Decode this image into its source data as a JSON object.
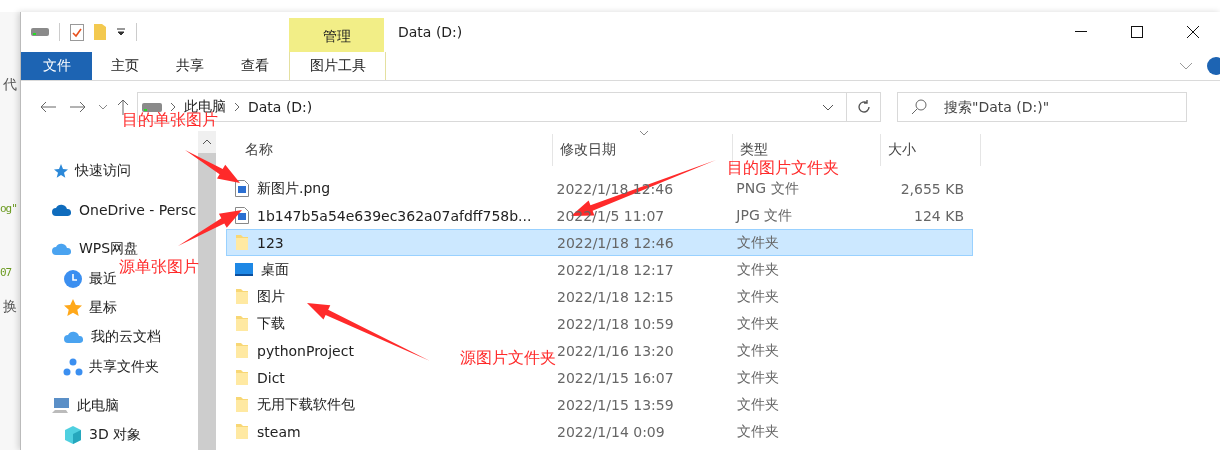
{
  "background_page": {
    "side_texts": [
      {
        "text": "代",
        "kind": "text"
      },
      {
        "text": "og\"",
        "kind": "code"
      },
      {
        "text": "07",
        "kind": "code"
      },
      {
        "text": "换",
        "kind": "text"
      }
    ]
  },
  "window": {
    "title": "Data (D:)"
  },
  "ribbon": {
    "contextual_header": "管理",
    "tabs": [
      {
        "label": "文件",
        "kind": "file"
      },
      {
        "label": "主页",
        "kind": "normal"
      },
      {
        "label": "共享",
        "kind": "normal"
      },
      {
        "label": "查看",
        "kind": "normal"
      },
      {
        "label": "图片工具",
        "kind": "contextual"
      }
    ]
  },
  "address_bar": {
    "breadcrumbs": [
      "此电脑",
      "Data (D:)"
    ]
  },
  "search": {
    "placeholder": "搜索\"Data (D:)\""
  },
  "navigation_pane": {
    "items": [
      {
        "label": "快速访问",
        "kind": "star"
      },
      {
        "label": "OneDrive - Persc",
        "kind": "onedrive"
      },
      {
        "label": "WPS网盘",
        "kind": "cloud",
        "children": [
          {
            "label": "最近",
            "kind": "clock"
          },
          {
            "label": "星标",
            "kind": "starfill"
          },
          {
            "label": "我的云文档",
            "kind": "cloud"
          },
          {
            "label": "共享文件夹",
            "kind": "share"
          }
        ]
      },
      {
        "label": "此电脑",
        "kind": "pc",
        "children": [
          {
            "label": "3D 对象",
            "kind": "cube"
          }
        ]
      }
    ]
  },
  "file_list": {
    "columns": [
      {
        "label": "名称",
        "sorted": false
      },
      {
        "label": "修改日期",
        "sorted": true
      },
      {
        "label": "类型",
        "sorted": false
      },
      {
        "label": "大小",
        "sorted": false
      }
    ],
    "rows": [
      {
        "name": "新图片.png",
        "date": "2022/1/18 12:46",
        "type": "PNG 文件",
        "size": "2,655 KB",
        "kind": "image",
        "selected": false
      },
      {
        "name": "1b147b5a54e639ec362a07afdff758b...",
        "date": "2022/1/5 11:07",
        "type": "JPG 文件",
        "size": "124 KB",
        "kind": "image",
        "selected": false
      },
      {
        "name": "123",
        "date": "2022/1/18 12:46",
        "type": "文件夹",
        "kind": "folder",
        "selected": true
      },
      {
        "name": "桌面",
        "date": "2022/1/18 12:17",
        "type": "文件夹",
        "kind": "desktop",
        "selected": false
      },
      {
        "name": "图片",
        "date": "2022/1/18 12:15",
        "type": "文件夹",
        "kind": "folder",
        "selected": false
      },
      {
        "name": "下载",
        "date": "2022/1/18 10:59",
        "type": "文件夹",
        "kind": "folder",
        "selected": false
      },
      {
        "name": "pythonProject",
        "date": "2022/1/16 13:20",
        "type": "文件夹",
        "kind": "folder",
        "selected": false
      },
      {
        "name": "Dict",
        "date": "2022/1/15 16:07",
        "type": "文件夹",
        "kind": "folder",
        "selected": false
      },
      {
        "name": "无用下载软件包",
        "date": "2022/1/15 13:59",
        "type": "文件夹",
        "kind": "folder",
        "selected": false
      },
      {
        "name": "steam",
        "date": "2022/1/14 0:09",
        "type": "文件夹",
        "kind": "folder",
        "selected": false
      }
    ]
  },
  "annotations": [
    {
      "text": "目的单张图片"
    },
    {
      "text": "源单张图片"
    },
    {
      "text": "目的图片文件夹"
    },
    {
      "text": "源图片文件夹"
    }
  ]
}
